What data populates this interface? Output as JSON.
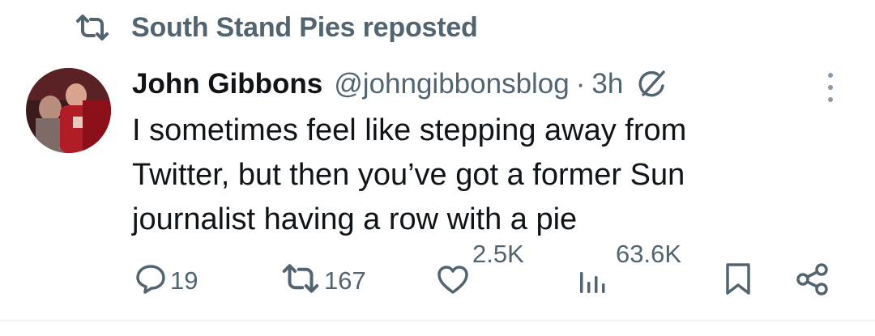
{
  "repost": {
    "icon": "repost-icon",
    "text": "South Stand Pies reposted"
  },
  "author": {
    "name": "John Gibbons",
    "handle": "@johngibbonsblog",
    "separator": "·",
    "time": "3h"
  },
  "tweet": {
    "lines": [
      "I sometimes feel like stepping away from",
      "Twitter, but then you’ve got a former Sun",
      "journalist having a row with a pie"
    ]
  },
  "actions": {
    "reply_count": "19",
    "repost_count": "167",
    "like_count": "2.5K",
    "views_count": "63.6K"
  },
  "icons": [
    "repost-icon",
    "grok-icon",
    "more-icon",
    "reply-icon",
    "retweet-icon",
    "like-icon",
    "views-icon",
    "bookmark-icon",
    "share-icon"
  ],
  "colors": {
    "text": "#0f1419",
    "muted": "#536471",
    "more_dots": "#8b98a5"
  }
}
